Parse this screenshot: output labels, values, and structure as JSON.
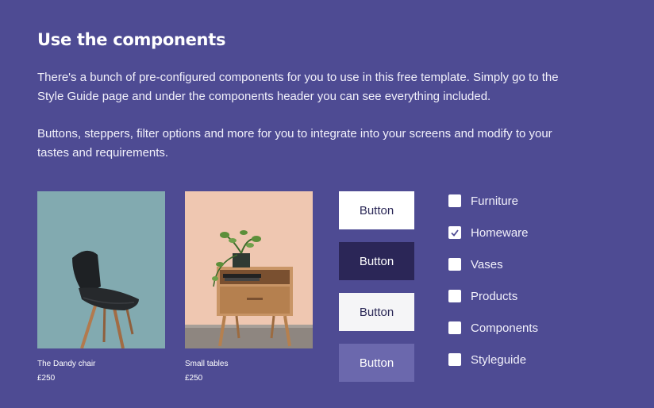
{
  "section": {
    "title": "Use the components",
    "paragraph1": "There's a bunch of pre-configured components for you to use in this free template. Simply go to the Style Guide page and under the components header you can see everything included.",
    "paragraph2": "Buttons, steppers, filter options and more for you to integrate into your screens and modify to your tastes and requirements."
  },
  "products": [
    {
      "name": "The Dandy chair",
      "price": "£250"
    },
    {
      "name": "Small tables",
      "price": "£250"
    }
  ],
  "buttons": [
    {
      "label": "Button",
      "variant": "white"
    },
    {
      "label": "Button",
      "variant": "dark"
    },
    {
      "label": "Button",
      "variant": "light"
    },
    {
      "label": "Button",
      "variant": "muted"
    }
  ],
  "filters": [
    {
      "label": "Furniture",
      "checked": false
    },
    {
      "label": "Homeware",
      "checked": true
    },
    {
      "label": "Vases",
      "checked": false
    },
    {
      "label": "Products",
      "checked": false
    },
    {
      "label": "Components",
      "checked": false
    },
    {
      "label": "Styleguide",
      "checked": false
    }
  ],
  "colors": {
    "background": "#4e4b93",
    "button_dark": "#2b2657",
    "button_muted": "#6b68ad",
    "chair_bg": "#82aab0",
    "table_bg": "#efc7b1"
  }
}
